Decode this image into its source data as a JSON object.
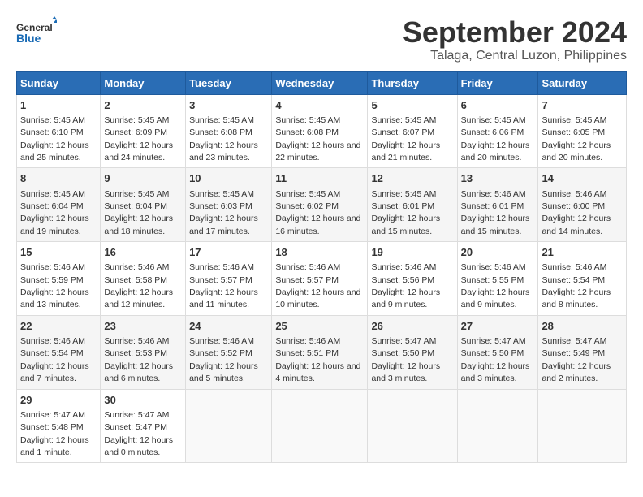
{
  "logo": {
    "text_general": "General",
    "text_blue": "Blue"
  },
  "title": "September 2024",
  "subtitle": "Talaga, Central Luzon, Philippines",
  "days_of_week": [
    "Sunday",
    "Monday",
    "Tuesday",
    "Wednesday",
    "Thursday",
    "Friday",
    "Saturday"
  ],
  "weeks": [
    [
      {
        "day": 1,
        "sunrise": "5:45 AM",
        "sunset": "6:10 PM",
        "daylight": "12 hours and 25 minutes."
      },
      {
        "day": 2,
        "sunrise": "5:45 AM",
        "sunset": "6:09 PM",
        "daylight": "12 hours and 24 minutes."
      },
      {
        "day": 3,
        "sunrise": "5:45 AM",
        "sunset": "6:08 PM",
        "daylight": "12 hours and 23 minutes."
      },
      {
        "day": 4,
        "sunrise": "5:45 AM",
        "sunset": "6:08 PM",
        "daylight": "12 hours and 22 minutes."
      },
      {
        "day": 5,
        "sunrise": "5:45 AM",
        "sunset": "6:07 PM",
        "daylight": "12 hours and 21 minutes."
      },
      {
        "day": 6,
        "sunrise": "5:45 AM",
        "sunset": "6:06 PM",
        "daylight": "12 hours and 20 minutes."
      },
      {
        "day": 7,
        "sunrise": "5:45 AM",
        "sunset": "6:05 PM",
        "daylight": "12 hours and 20 minutes."
      }
    ],
    [
      {
        "day": 8,
        "sunrise": "5:45 AM",
        "sunset": "6:04 PM",
        "daylight": "12 hours and 19 minutes."
      },
      {
        "day": 9,
        "sunrise": "5:45 AM",
        "sunset": "6:04 PM",
        "daylight": "12 hours and 18 minutes."
      },
      {
        "day": 10,
        "sunrise": "5:45 AM",
        "sunset": "6:03 PM",
        "daylight": "12 hours and 17 minutes."
      },
      {
        "day": 11,
        "sunrise": "5:45 AM",
        "sunset": "6:02 PM",
        "daylight": "12 hours and 16 minutes."
      },
      {
        "day": 12,
        "sunrise": "5:45 AM",
        "sunset": "6:01 PM",
        "daylight": "12 hours and 15 minutes."
      },
      {
        "day": 13,
        "sunrise": "5:46 AM",
        "sunset": "6:01 PM",
        "daylight": "12 hours and 15 minutes."
      },
      {
        "day": 14,
        "sunrise": "5:46 AM",
        "sunset": "6:00 PM",
        "daylight": "12 hours and 14 minutes."
      }
    ],
    [
      {
        "day": 15,
        "sunrise": "5:46 AM",
        "sunset": "5:59 PM",
        "daylight": "12 hours and 13 minutes."
      },
      {
        "day": 16,
        "sunrise": "5:46 AM",
        "sunset": "5:58 PM",
        "daylight": "12 hours and 12 minutes."
      },
      {
        "day": 17,
        "sunrise": "5:46 AM",
        "sunset": "5:57 PM",
        "daylight": "12 hours and 11 minutes."
      },
      {
        "day": 18,
        "sunrise": "5:46 AM",
        "sunset": "5:57 PM",
        "daylight": "12 hours and 10 minutes."
      },
      {
        "day": 19,
        "sunrise": "5:46 AM",
        "sunset": "5:56 PM",
        "daylight": "12 hours and 9 minutes."
      },
      {
        "day": 20,
        "sunrise": "5:46 AM",
        "sunset": "5:55 PM",
        "daylight": "12 hours and 9 minutes."
      },
      {
        "day": 21,
        "sunrise": "5:46 AM",
        "sunset": "5:54 PM",
        "daylight": "12 hours and 8 minutes."
      }
    ],
    [
      {
        "day": 22,
        "sunrise": "5:46 AM",
        "sunset": "5:54 PM",
        "daylight": "12 hours and 7 minutes."
      },
      {
        "day": 23,
        "sunrise": "5:46 AM",
        "sunset": "5:53 PM",
        "daylight": "12 hours and 6 minutes."
      },
      {
        "day": 24,
        "sunrise": "5:46 AM",
        "sunset": "5:52 PM",
        "daylight": "12 hours and 5 minutes."
      },
      {
        "day": 25,
        "sunrise": "5:46 AM",
        "sunset": "5:51 PM",
        "daylight": "12 hours and 4 minutes."
      },
      {
        "day": 26,
        "sunrise": "5:47 AM",
        "sunset": "5:50 PM",
        "daylight": "12 hours and 3 minutes."
      },
      {
        "day": 27,
        "sunrise": "5:47 AM",
        "sunset": "5:50 PM",
        "daylight": "12 hours and 3 minutes."
      },
      {
        "day": 28,
        "sunrise": "5:47 AM",
        "sunset": "5:49 PM",
        "daylight": "12 hours and 2 minutes."
      }
    ],
    [
      {
        "day": 29,
        "sunrise": "5:47 AM",
        "sunset": "5:48 PM",
        "daylight": "12 hours and 1 minute."
      },
      {
        "day": 30,
        "sunrise": "5:47 AM",
        "sunset": "5:47 PM",
        "daylight": "12 hours and 0 minutes."
      },
      null,
      null,
      null,
      null,
      null
    ]
  ]
}
